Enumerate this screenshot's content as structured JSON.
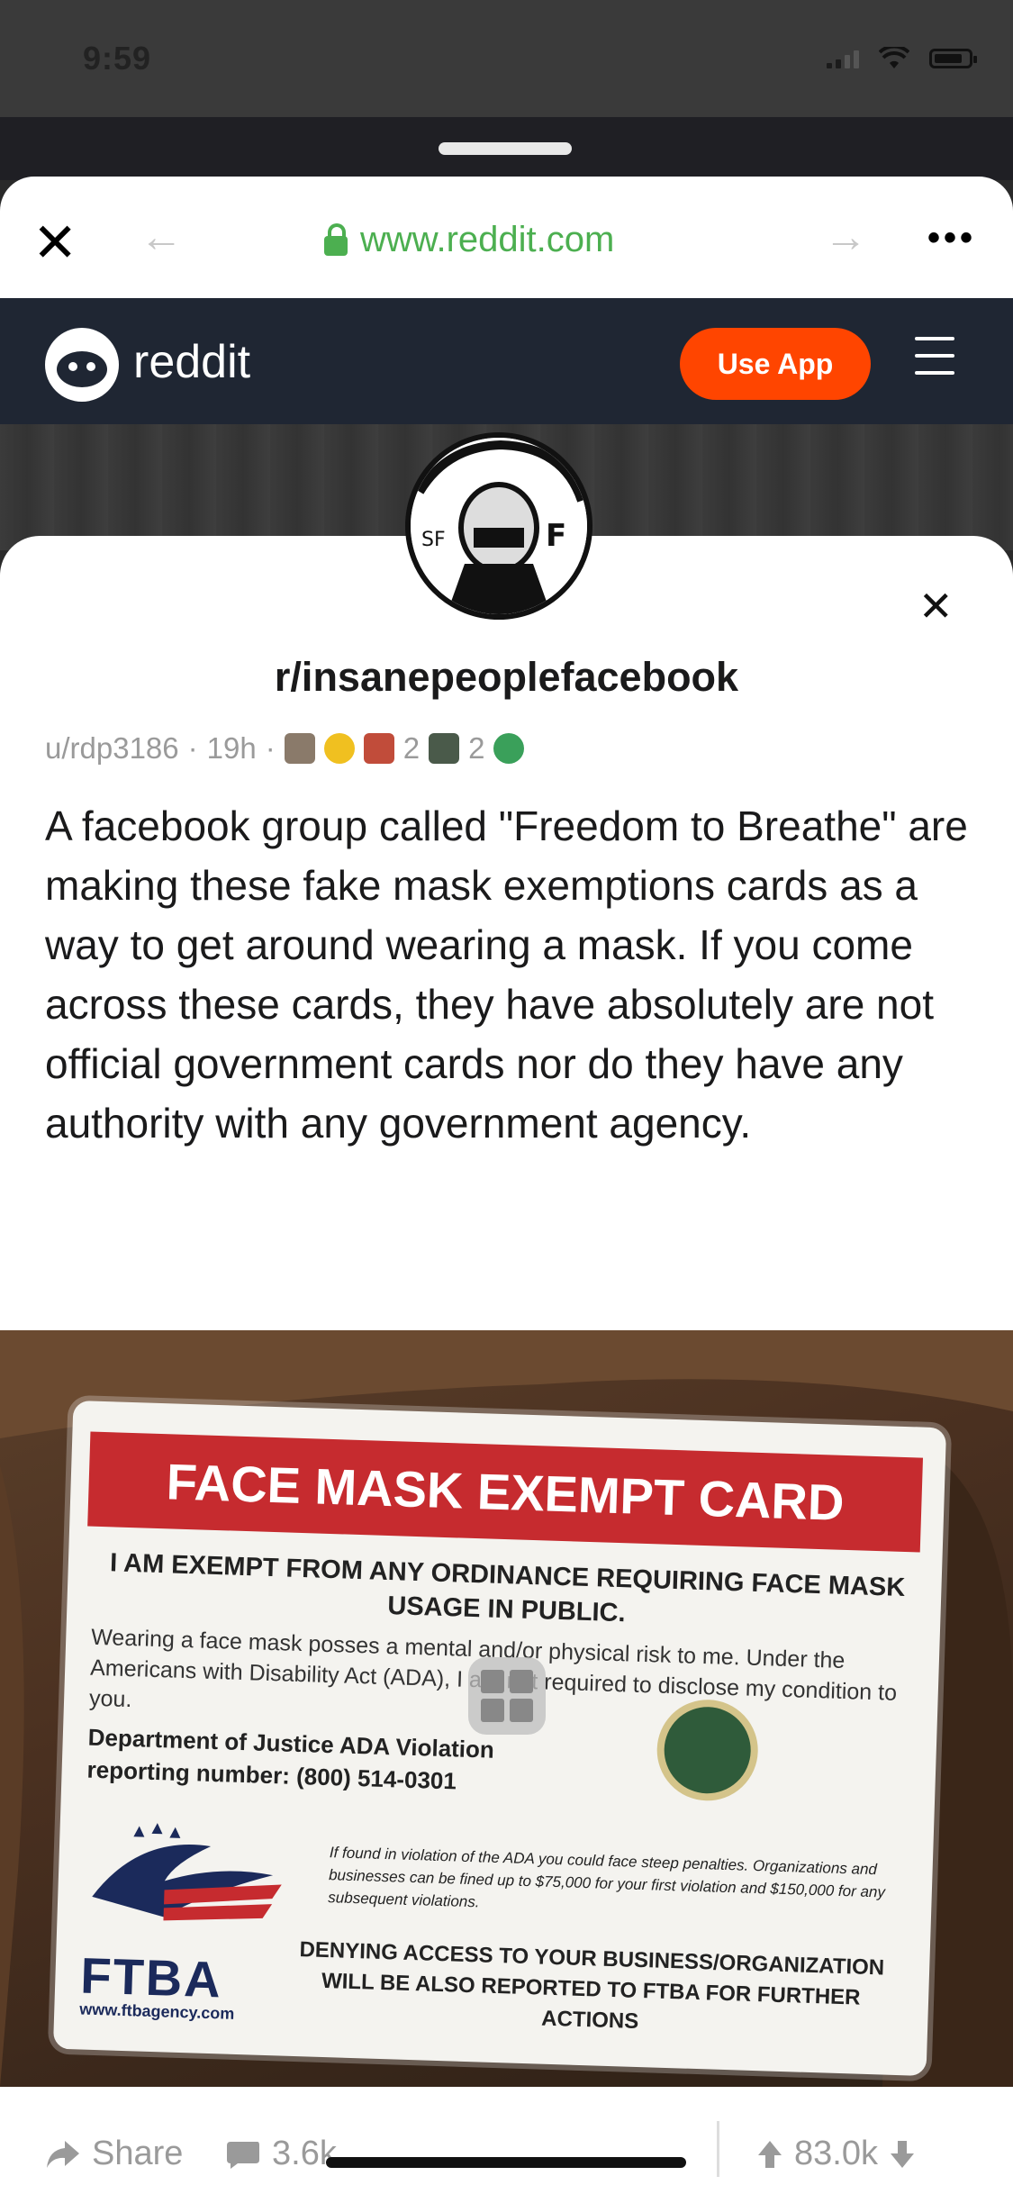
{
  "status_bar": {
    "time": "9:59"
  },
  "browser": {
    "url": "www.reddit.com"
  },
  "reddit_header": {
    "logo_text": "reddit",
    "use_app_label": "Use App"
  },
  "post": {
    "subreddit": "r/insanepeoplefacebook",
    "author": "u/rdp3186",
    "age": "19h",
    "award_counts": [
      "2",
      "2"
    ],
    "body": "A facebook group called \"Freedom to Breathe\" are making these fake mask exemptions cards as a way to get around wearing a mask. If you come across these cards, they have absolutely are not official government cards nor do they have any authority with any government agency."
  },
  "image_card": {
    "title": "FACE MASK EXEMPT CARD",
    "line1": "I AM EXEMPT FROM ANY ORDINANCE REQUIRING FACE MASK USAGE IN PUBLIC.",
    "body": "Wearing a face mask posses a mental and/or physical risk to me. Under the Americans with Disability Act (ADA), I am not required to disclose my condition to you.",
    "dept": "Department of Justice ADA Violation",
    "reporting": "reporting number: (800) 514-0301",
    "fine": "If found in violation of the ADA you could face steep penalties. Organizations and businesses can be fined up to $75,000 for your first violation and $150,000 for any subsequent violations.",
    "deny": "DENYING ACCESS TO YOUR BUSINESS/ORGANIZATION WILL BE ALSO REPORTED TO FTBA FOR FURTHER ACTIONS",
    "brand": "FTBA",
    "brand_url": "www.ftbagency.com"
  },
  "actions": {
    "share": "Share",
    "comments": "3.6k",
    "score": "83.0k"
  },
  "colors": {
    "reddit_orange": "#ff4500",
    "header_bg": "#1f2633",
    "url_green": "#4caf50",
    "card_red": "#c62b2f"
  }
}
